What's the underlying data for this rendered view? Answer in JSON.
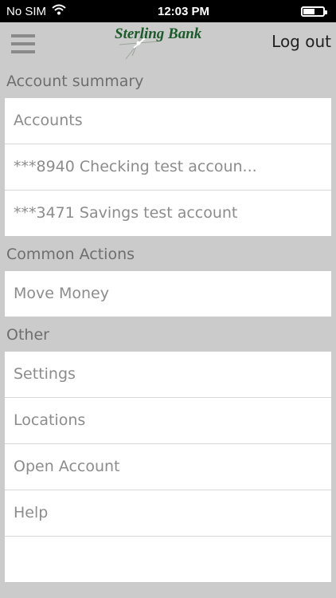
{
  "status_bar": {
    "carrier": "No SIM",
    "time": "12:03 PM",
    "battery_level": 0.55
  },
  "nav": {
    "brand": "Sterling Bank",
    "logout_label": "Log out"
  },
  "sections": [
    {
      "title": "Account summary",
      "items": [
        "Accounts",
        "***8940 Checking test accoun...",
        "***3471 Savings test account"
      ]
    },
    {
      "title": "Common Actions",
      "items": [
        "Move Money"
      ]
    },
    {
      "title": "Other",
      "items": [
        "Settings",
        "Locations",
        "Open Account",
        "Help",
        ""
      ]
    }
  ],
  "colors": {
    "brand_green": "#1c5a2a",
    "background_gray": "#cbcbcb"
  }
}
